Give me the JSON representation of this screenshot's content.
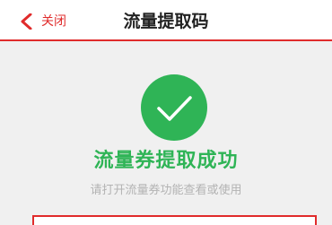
{
  "navbar": {
    "back_label": "关闭",
    "title": "流量提取码"
  },
  "result": {
    "icon": "check-circle-icon",
    "title": "流量券提取成功",
    "subtitle": "请打开流量券功能查看或使用"
  },
  "colors": {
    "accent_red": "#e02b2b",
    "success_green": "#2fb456",
    "hint_gray": "#b3b3b3",
    "page_bg": "#f0f0f0"
  }
}
